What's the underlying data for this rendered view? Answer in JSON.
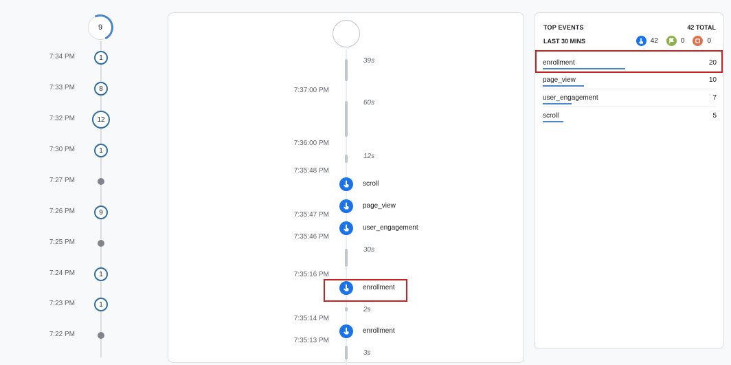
{
  "left_timeline": {
    "top_count": "9",
    "rows": [
      {
        "time": "7:34 PM",
        "count": "1"
      },
      {
        "time": "7:33 PM",
        "count": "8"
      },
      {
        "time": "7:32 PM",
        "count": "12"
      },
      {
        "time": "7:30 PM",
        "count": "1"
      },
      {
        "time": "7:27 PM",
        "count": ""
      },
      {
        "time": "7:26 PM",
        "count": "9"
      },
      {
        "time": "7:25 PM",
        "count": ""
      },
      {
        "time": "7:24 PM",
        "count": "1"
      },
      {
        "time": "7:23 PM",
        "count": "1"
      },
      {
        "time": "7:22 PM",
        "count": ""
      }
    ]
  },
  "stream": {
    "durations": [
      "39s",
      "60s",
      "12s",
      "30s",
      "2s",
      "3s"
    ],
    "times": [
      "7:37:00 PM",
      "7:36:00 PM",
      "7:35:48 PM",
      "7:35:47 PM",
      "7:35:46 PM",
      "7:35:16 PM",
      "7:35:14 PM",
      "7:35:13 PM"
    ],
    "events": [
      "scroll",
      "page_view",
      "user_engagement",
      "enrollment",
      "enrollment"
    ]
  },
  "top_events": {
    "title": "TOP EVENTS",
    "total": "42 TOTAL",
    "period": "LAST 30 MINS",
    "counts": {
      "clicks": "42",
      "conversions": "0",
      "errors": "0"
    },
    "colors": {
      "clicks": "#1a73e8",
      "conversions": "#8ab34a",
      "errors": "#e0714c"
    },
    "items": [
      {
        "name": "enrollment",
        "value": "20",
        "share": 1.0
      },
      {
        "name": "page_view",
        "value": "10",
        "share": 0.5
      },
      {
        "name": "user_engagement",
        "value": "7",
        "share": 0.35
      },
      {
        "name": "scroll",
        "value": "5",
        "share": 0.25
      }
    ]
  }
}
